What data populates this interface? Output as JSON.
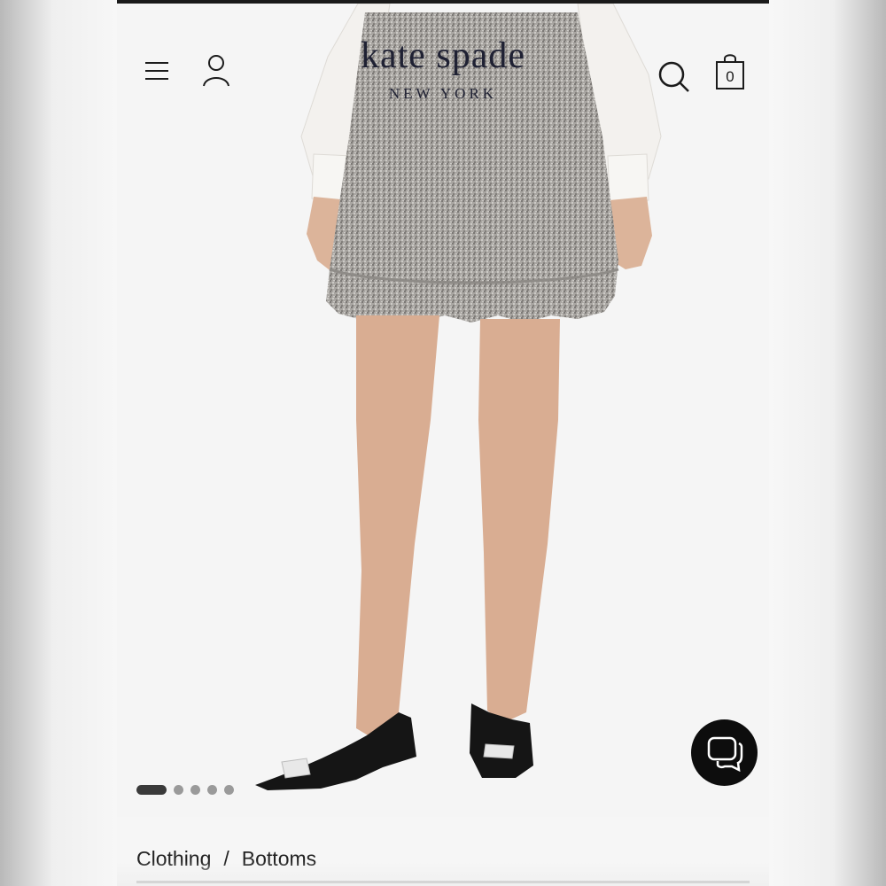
{
  "header": {
    "menu_icon": "hamburger-menu-icon",
    "account_icon": "person-icon",
    "search_icon": "search-icon",
    "bag_icon": "shopping-bag-icon",
    "bag_count": "0"
  },
  "logo": {
    "main": "kate spade",
    "sub": "NEW YORK"
  },
  "gallery": {
    "slide_count": 5,
    "active_index": 0
  },
  "chat": {
    "icon": "chat-bubbles-icon"
  },
  "breadcrumb": {
    "items": [
      "Clothing",
      "Bottoms"
    ],
    "separator": "/"
  },
  "colors": {
    "accent": "#1f2133",
    "chat_bg": "#0d0d0d"
  }
}
